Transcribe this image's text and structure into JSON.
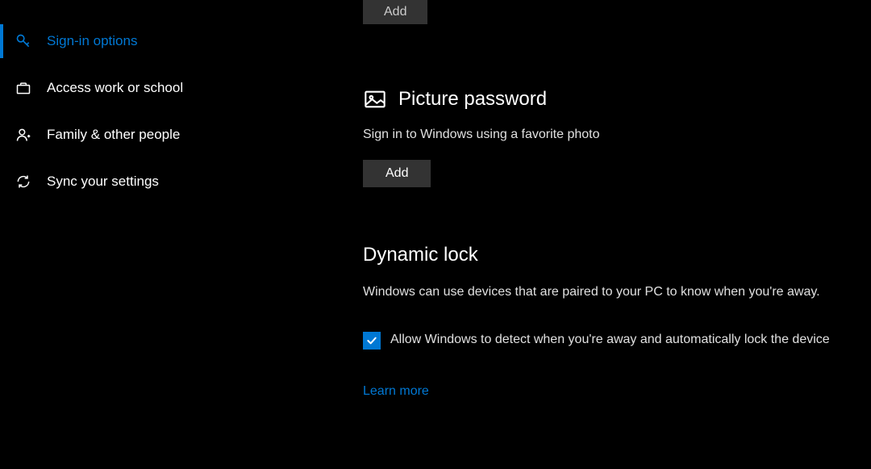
{
  "sidebar": {
    "items": [
      {
        "label": "Sign-in options",
        "icon": "key-icon",
        "active": true
      },
      {
        "label": "Access work or school",
        "icon": "briefcase-icon",
        "active": false
      },
      {
        "label": "Family & other people",
        "icon": "person-plus-icon",
        "active": false
      },
      {
        "label": "Sync your settings",
        "icon": "sync-icon",
        "active": false
      }
    ]
  },
  "main": {
    "top_add_label": "Add",
    "picture_password": {
      "heading": "Picture password",
      "desc": "Sign in to Windows using a favorite photo",
      "add_label": "Add"
    },
    "dynamic_lock": {
      "heading": "Dynamic lock",
      "body": "Windows can use devices that are paired to your PC to know when you're away.",
      "checkbox_label": "Allow Windows to detect when you're away and automatically lock the device",
      "checked": true,
      "learn_more": "Learn more"
    }
  },
  "colors": {
    "accent": "#0078d4",
    "background": "#000000",
    "button_bg": "#333333"
  }
}
